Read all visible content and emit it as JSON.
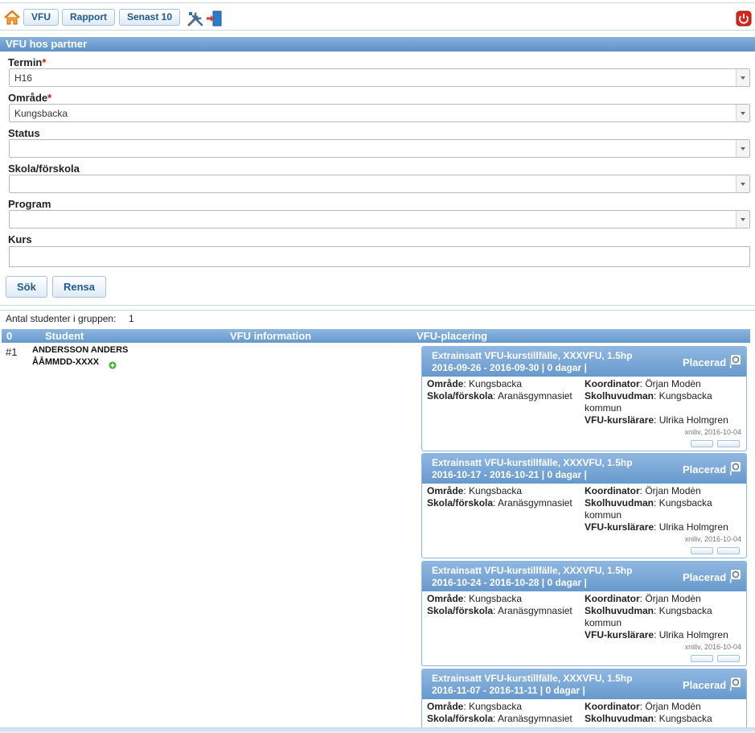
{
  "toolbar": {
    "buttons": [
      "VFU",
      "Rapport",
      "Senast 10"
    ],
    "icons": [
      "home-icon",
      "tools-icon",
      "logout-icon",
      "power-icon"
    ]
  },
  "section": {
    "title": "VFU hos partner"
  },
  "form": {
    "required_mark": "*",
    "termin": {
      "label": "Termin",
      "value": "H16"
    },
    "omrade": {
      "label": "Område",
      "value": "Kungsbacka"
    },
    "status": {
      "label": "Status",
      "value": ""
    },
    "skola": {
      "label": "Skola/förskola",
      "value": ""
    },
    "program": {
      "label": "Program",
      "value": ""
    },
    "kurs": {
      "label": "Kurs",
      "value": ""
    },
    "search_label": "Sök",
    "clear_label": "Rensa"
  },
  "results": {
    "count_label": "Antal studenter i gruppen:",
    "count": "1",
    "columns": [
      "0",
      "Student",
      "VFU information",
      "VFU-placering"
    ],
    "rows": [
      {
        "num": "#1",
        "name": "ANDERSSON ANDERS",
        "id": "ÅÅMMDD-XXXX",
        "placements": [
          {
            "title": "Extrainsatt VFU-kurstillfälle, XXXVFU, 1.5hp",
            "dates": "2016-09-26 - 2016-09-30 | 0 dagar |",
            "status": "Placerad |",
            "omrade_label": "Område",
            "omrade": ": Kungsbacka",
            "skola_label": "Skola/förskola",
            "skola": ": Aranäsgymnasiet",
            "koordinator_label": "Koordinator",
            "koordinator": ":  Örjan Modèn",
            "huvudman_label": "Skolhuvudman",
            "huvudman": ":  Kungsbacka",
            "huvudman_cont": "kommun",
            "larare_label": "VFU-kurslärare",
            "larare": ":  Ulrika Holmgren",
            "meta": "xniliv, 2016-10-04"
          },
          {
            "title": "Extrainsatt VFU-kurstillfälle, XXXVFU, 1.5hp",
            "dates": "2016-10-17 - 2016-10-21 | 0 dagar |",
            "status": "Placerad |",
            "omrade_label": "Område",
            "omrade": ": Kungsbacka",
            "skola_label": "Skola/förskola",
            "skola": ": Aranäsgymnasiet",
            "koordinator_label": "Koordinator",
            "koordinator": ":  Örjan Modèn",
            "huvudman_label": "Skolhuvudman",
            "huvudman": ":  Kungsbacka",
            "huvudman_cont": "kommun",
            "larare_label": "VFU-kurslärare",
            "larare": ":  Ulrika Holmgren",
            "meta": "xniliv, 2016-10-04"
          },
          {
            "title": "Extrainsatt VFU-kurstillfälle, XXXVFU, 1.5hp",
            "dates": "2016-10-24 - 2016-10-28 | 0 dagar |",
            "status": "Placerad |",
            "omrade_label": "Område",
            "omrade": ": Kungsbacka",
            "skola_label": "Skola/förskola",
            "skola": ": Aranäsgymnasiet",
            "koordinator_label": "Koordinator",
            "koordinator": ":  Örjan Modèn",
            "huvudman_label": "Skolhuvudman",
            "huvudman": ":  Kungsbacka",
            "huvudman_cont": "kommun",
            "larare_label": "VFU-kurslärare",
            "larare": ":  Ulrika Holmgren",
            "meta": "xniliv, 2016-10-04"
          },
          {
            "title": "Extrainsatt VFU-kurstillfälle, XXXVFU, 1.5hp",
            "dates": "2016-11-07 - 2016-11-11 | 0 dagar |",
            "status": "Placerad |",
            "omrade_label": "Område",
            "omrade": ": Kungsbacka",
            "skola_label": "Skola/förskola",
            "skola": ": Aranäsgymnasiet",
            "koordinator_label": "Koordinator",
            "koordinator": ":  Örjan Modèn",
            "huvudman_label": "Skolhuvudman",
            "huvudman": ":  Kungsbacka"
          }
        ]
      }
    ]
  }
}
